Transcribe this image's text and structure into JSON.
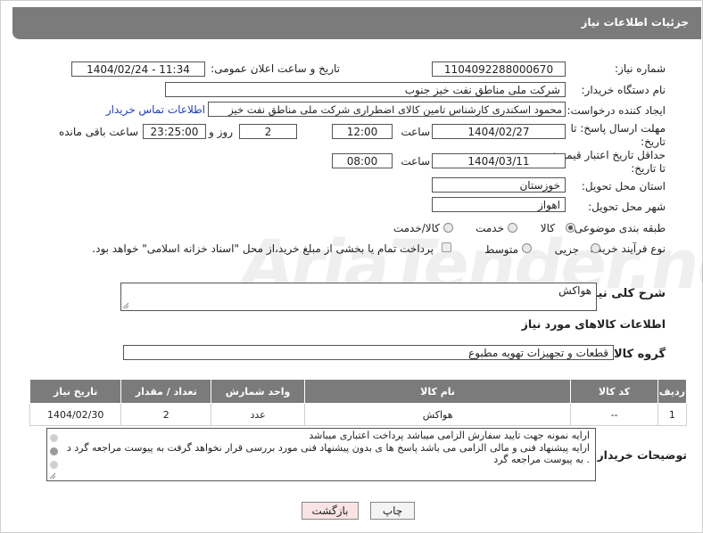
{
  "header": {
    "title": "جزئیات اطلاعات نیاز"
  },
  "fields": {
    "need_number_label": "شماره نیاز:",
    "need_number": "1104092288000670",
    "announce_label": "تاریخ و ساعت اعلان عمومی:",
    "announce_value": "1404/02/24 - 11:34",
    "buyer_org_label": "نام دستگاه خریدار:",
    "buyer_org": "شرکت ملی مناطق نفت خیز جنوب",
    "creator_label": "ایجاد کننده درخواست:",
    "creator": "محمود  اسکندری کارشناس تامین کالای اضطراری شرکت ملی مناطق نفت خیز",
    "contact_link": "اطلاعات تماس خریدار",
    "deadline_label_1": "مهلت ارسال پاسخ: تا",
    "deadline_label_2": "تاریخ:",
    "deadline_date": "1404/02/27",
    "time_label": "ساعت",
    "deadline_time": "12:00",
    "days_value": "2",
    "days_label": "روز و",
    "remaining_value": "23:25:00",
    "remaining_label": "ساعت باقی مانده",
    "validity_label_1": "حداقل تاریخ اعتبار قیمت:",
    "validity_label_2": "تا تاریخ:",
    "validity_date": "1404/03/11",
    "validity_time": "08:00",
    "province_label": "استان محل تحویل:",
    "province": "خوزستان",
    "city_label": "شهر محل تحویل:",
    "city": "اهواز",
    "category_label": "طبقه بندی موضوعی:",
    "category_options": [
      "کالا",
      "خدمت",
      "کالا/خدمت"
    ],
    "process_label": "نوع فرآیند خرید :",
    "process_options": [
      "جزیی",
      "متوسط"
    ],
    "payment_note": "پرداخت تمام یا بخشی از مبلغ خرید،از محل \"اسناد خزانه اسلامی\" خواهد بود.",
    "description_label": "شرح کلی نیاز:",
    "description": "هواکش",
    "goods_section_title": "اطلاعات کالاهای مورد نیاز",
    "goods_group_label": "گروه کالا:",
    "goods_group": "قطعات و تجهیزات تهویه مطبوع"
  },
  "table": {
    "headers": [
      "ردیف",
      "کد کالا",
      "نام کالا",
      "واحد شمارش",
      "تعداد / مقدار",
      "تاریخ نیاز"
    ],
    "rows": [
      [
        "1",
        "--",
        "هواکش",
        "عدد",
        "2",
        "1404/02/30"
      ]
    ]
  },
  "buyer_notes": {
    "label": "توضیحات خریدار:",
    "lines": [
      "ارایه نمونه جهت تایید سفارش الزامی میباشد پرداخت اعتباری میباشد",
      "ارایه پیشنهاد فنی و مالی الزامی می باشد پاسخ ها ی بدون پیشنهاد فنی مورد بررسی قرار نخواهد گرفت به پیوست مراجعه گرد د",
      ". به پیوست مراجعه گرد"
    ]
  },
  "buttons": {
    "print": "چاپ",
    "back": "بازگشت"
  },
  "watermark": "AriaTender.net"
}
